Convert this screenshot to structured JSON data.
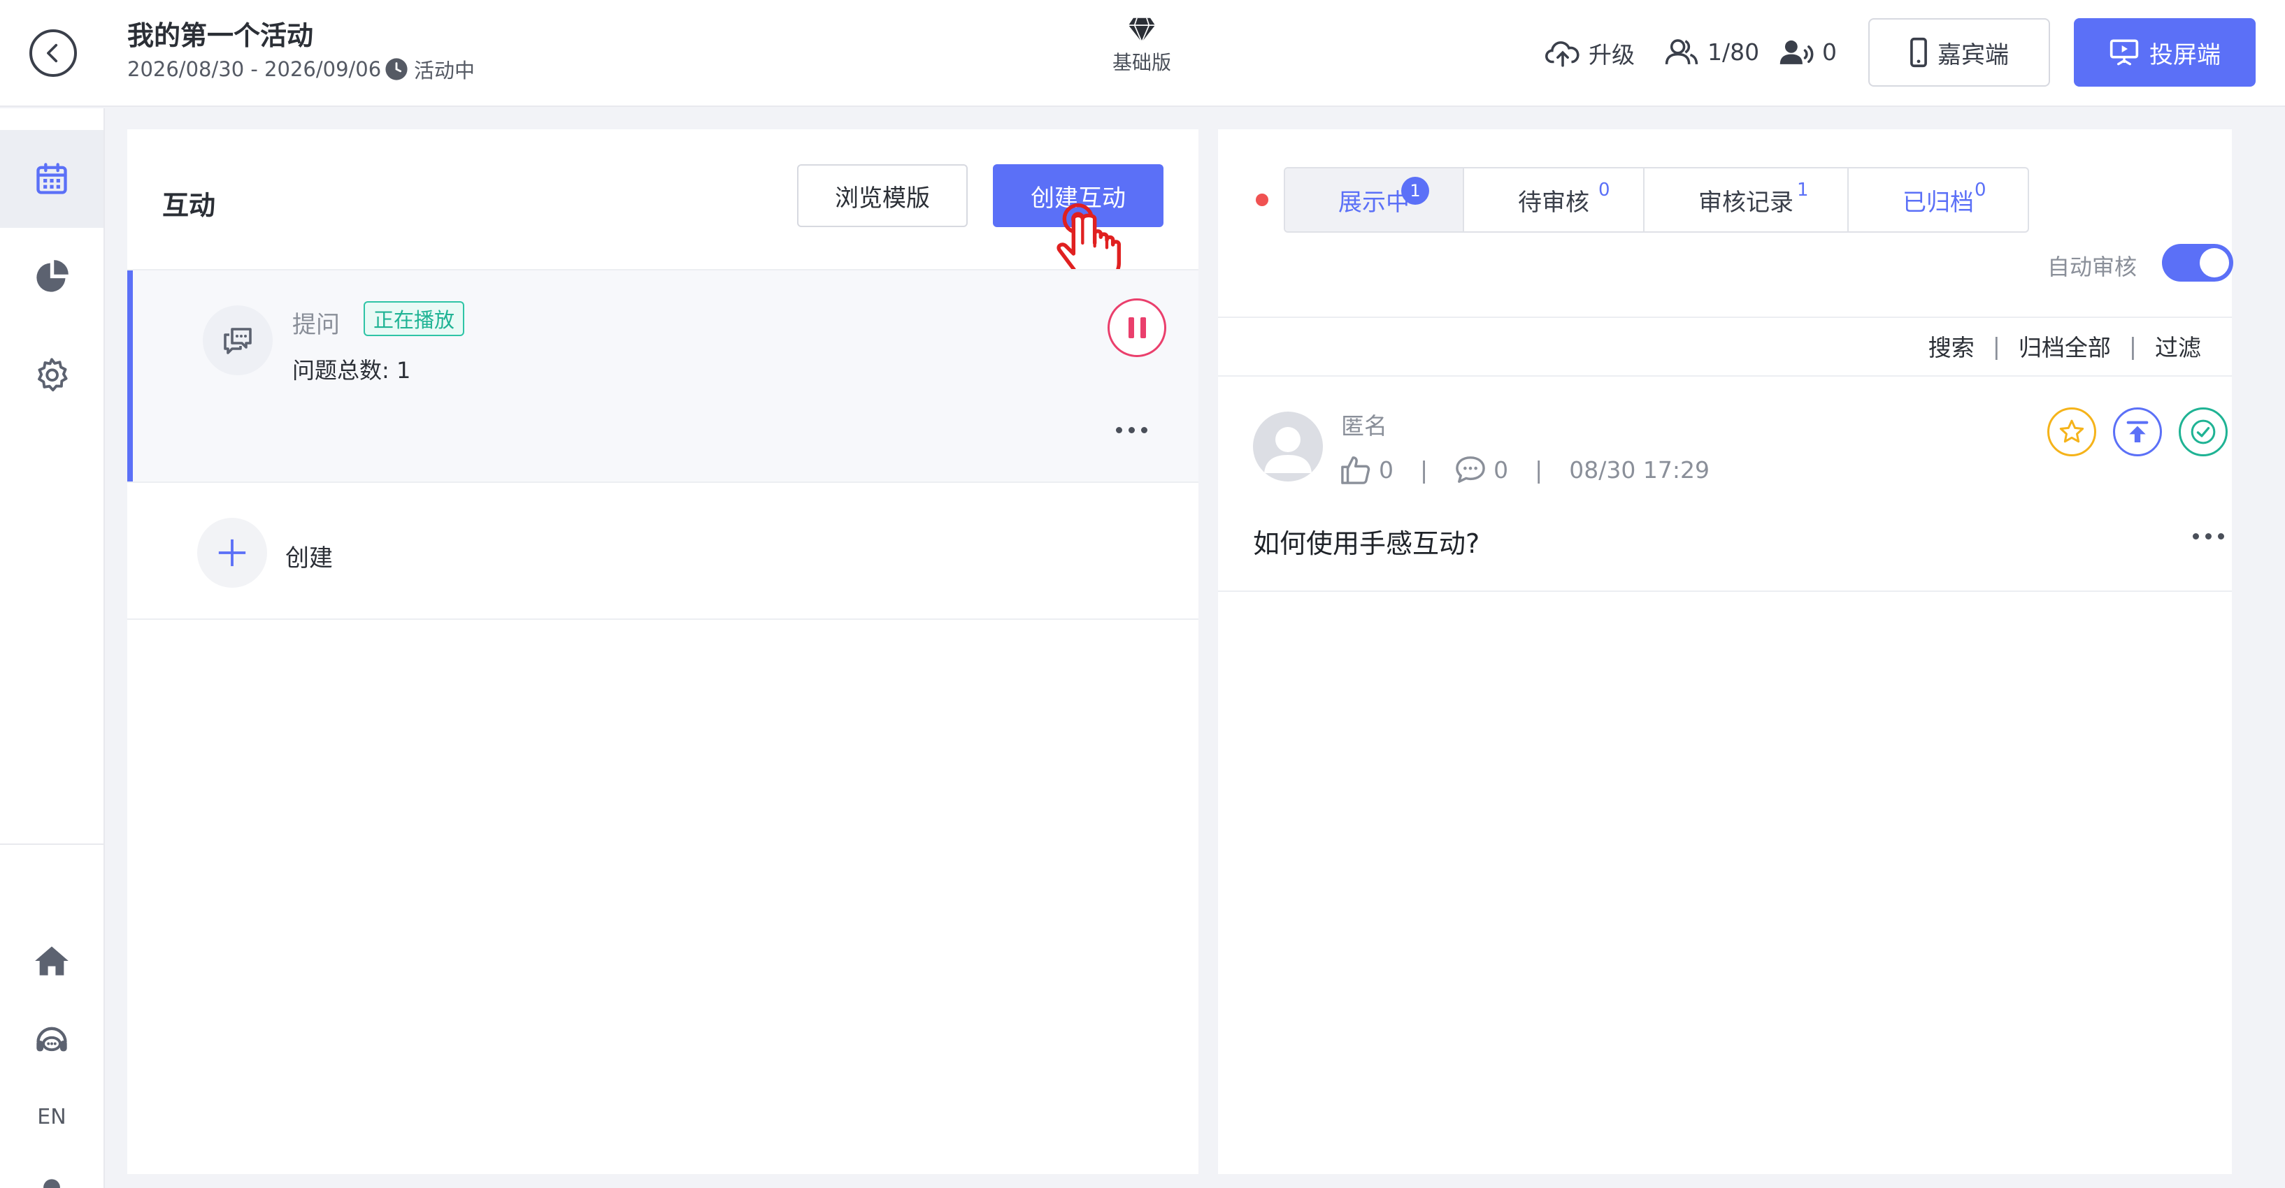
{
  "header": {
    "event_title": "我的第一个活动",
    "event_dates": "2026/08/30 - 2026/09/06",
    "event_status": "活动中",
    "plan_label": "基础版",
    "upgrade_label": "升级",
    "attendees_count": "1/80",
    "online_count": "0",
    "guest_button": "嘉宾端",
    "screen_button": "投屏端"
  },
  "sidebar": {
    "items": [
      {
        "name": "calendar-icon",
        "active": true
      },
      {
        "name": "pie-chart-icon",
        "active": false
      },
      {
        "name": "gear-icon",
        "active": false
      }
    ],
    "language": "EN"
  },
  "left_panel": {
    "title": "互动",
    "browse_button": "浏览模版",
    "create_button": "创建互动",
    "interaction": {
      "type_label": "提问",
      "status_badge": "正在播放",
      "count_text": "问题总数: 1"
    },
    "create_label": "创建"
  },
  "right_panel": {
    "tabs": [
      {
        "label": "展示中",
        "count": "1",
        "active": true
      },
      {
        "label": "待审核",
        "count": "0",
        "active": false
      },
      {
        "label": "审核记录",
        "count": "1",
        "active": false
      },
      {
        "label": "已归档",
        "count": "0",
        "active": false
      }
    ],
    "auto_review_label": "自动审核",
    "auto_review_on": true,
    "actions": {
      "search": "搜索",
      "archive_all": "归档全部",
      "filter": "过滤"
    },
    "question": {
      "author": "匿名",
      "likes": "0",
      "comments": "0",
      "time": "08/30 17:29",
      "text": "如何使用手感互动?"
    }
  },
  "colors": {
    "accent": "#5b70f7",
    "live": "#f05252",
    "playing_badge": "#2ec4a6",
    "pause": "#ea3f6c",
    "star": "#f5b31a",
    "approve": "#1fb394"
  }
}
